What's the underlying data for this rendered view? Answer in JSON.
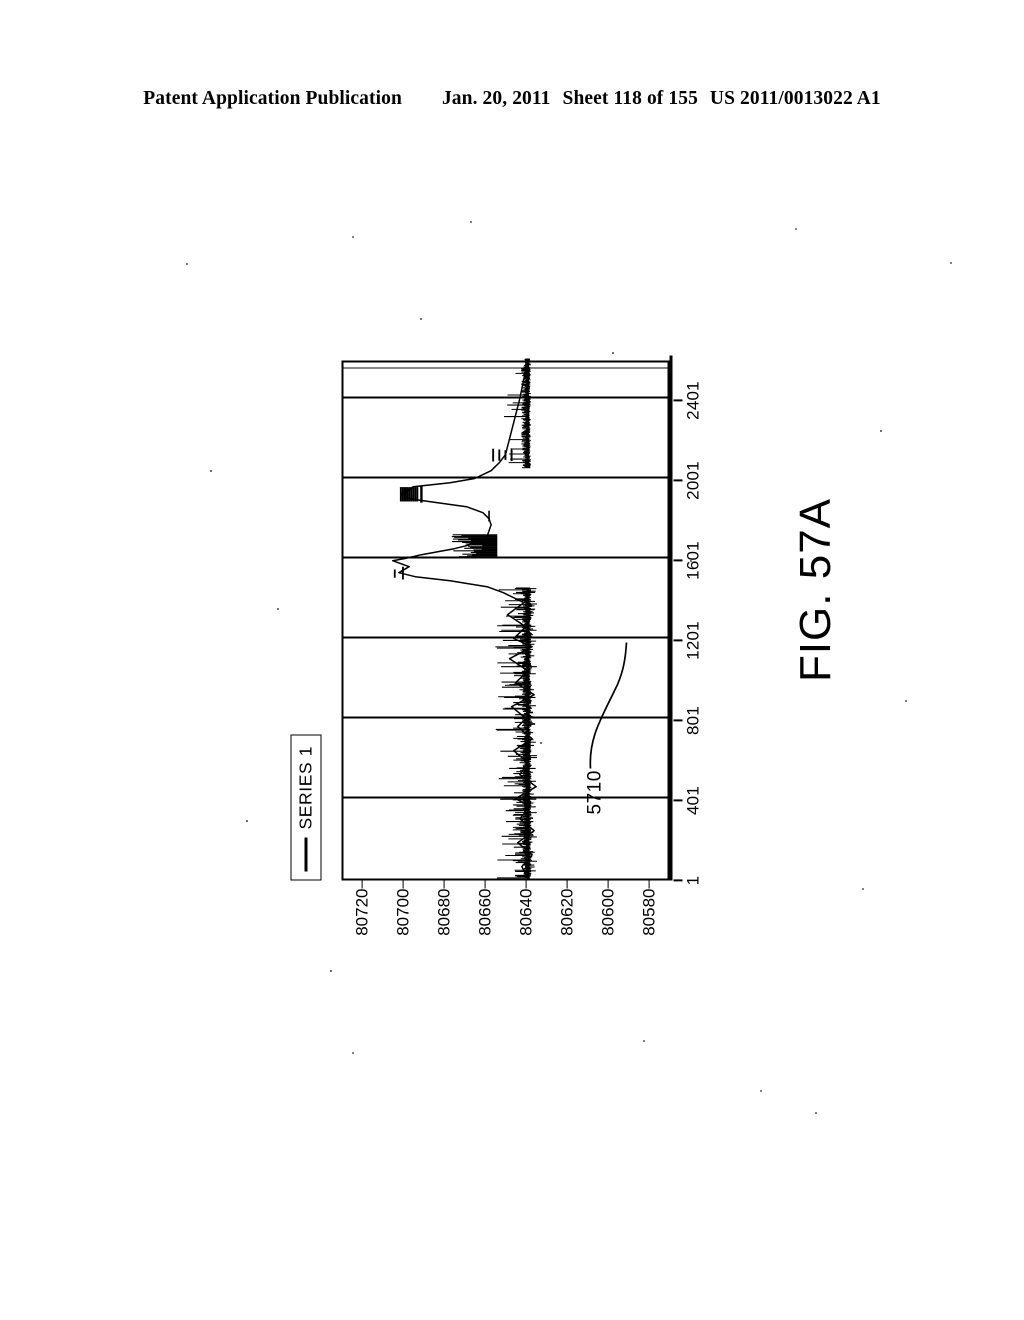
{
  "header": {
    "publication": "Patent Application Publication",
    "date": "Jan. 20, 2011",
    "sheet": "Sheet 118 of 155",
    "patent_number": "US 2011/0013022 A1"
  },
  "figure": {
    "caption": "FIG. 57A",
    "reference_numeral": "5710"
  },
  "legend": {
    "series_label": "SERIES 1"
  },
  "chart_data": {
    "type": "line",
    "title": "",
    "xlabel": "",
    "ylabel": "",
    "orientation": "rotated-90-ccw",
    "grid": true,
    "legend_position": "top-left",
    "legend_entries": [
      "SERIES 1"
    ],
    "xlim": [
      1,
      2601
    ],
    "ylim": [
      80570,
      80730
    ],
    "xticks": [
      1,
      401,
      801,
      1201,
      1601,
      2001,
      2401
    ],
    "yticks": [
      80580,
      80600,
      80620,
      80640,
      80660,
      80680,
      80700,
      80720
    ],
    "series": [
      {
        "name": "SERIES 1",
        "color": "#000000",
        "baseline": 80640,
        "description": "Dense noisy spectral trace: low-amplitude spiky baseline near 80640 from x=1 to about x=1450, then two tall excursions reaching about 80705 between x=1480 and x=1900, returning to baseline with a clipped cluster near x=1900-1960 and a short spiky tail from x=2050 to 2401.",
        "x": [
          1,
          60,
          120,
          180,
          240,
          300,
          360,
          401,
          460,
          520,
          580,
          640,
          700,
          760,
          801,
          860,
          920,
          980,
          1040,
          1100,
          1160,
          1201,
          1260,
          1320,
          1380,
          1430,
          1460,
          1490,
          1510,
          1530,
          1560,
          1590,
          1601,
          1620,
          1650,
          1680,
          1710,
          1740,
          1770,
          1800,
          1830,
          1860,
          1880,
          1900,
          1920,
          1940,
          1960,
          1980,
          2001,
          2040,
          2080,
          2120,
          2160,
          2200,
          2240,
          2280,
          2320,
          2360,
          2401,
          2450,
          2500,
          2560,
          2601
        ],
        "y": [
          80640,
          80643,
          80638,
          80645,
          80637,
          80644,
          80639,
          80646,
          80636,
          80644,
          80640,
          80647,
          80638,
          80645,
          80641,
          80648,
          80637,
          80646,
          80640,
          80649,
          80638,
          80647,
          80641,
          80650,
          80642,
          80652,
          80660,
          80678,
          80695,
          80703,
          80698,
          80706,
          80700,
          80692,
          80676,
          80664,
          80660,
          80659,
          80658,
          80659,
          80662,
          80670,
          80684,
          80698,
          80702,
          80699,
          80696,
          80678,
          80666,
          80658,
          80654,
          80651,
          80650,
          80649,
          80648,
          80647,
          80646,
          80645,
          80644,
          80643,
          80642,
          80641,
          80641
        ]
      }
    ]
  }
}
